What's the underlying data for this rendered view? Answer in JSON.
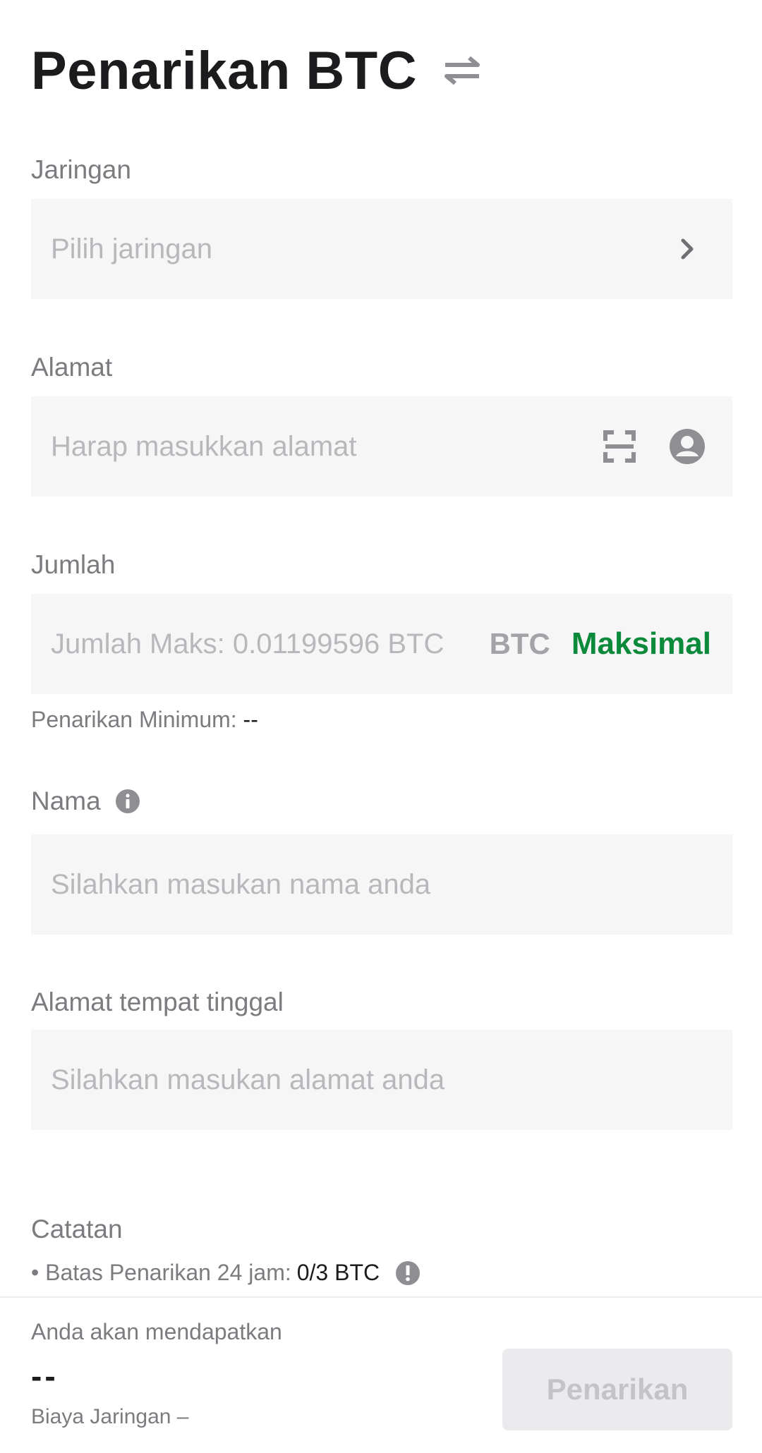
{
  "header": {
    "title": "Penarikan BTC",
    "swap_icon": "swap-arrows-icon"
  },
  "network": {
    "label": "Jaringan",
    "placeholder": "Pilih jaringan",
    "chevron_icon": "chevron-right-icon"
  },
  "address": {
    "label": "Alamat",
    "placeholder": "Harap masukkan alamat",
    "scan_icon": "scan-icon",
    "contact_icon": "contact-icon"
  },
  "amount": {
    "label": "Jumlah",
    "placeholder": "Jumlah Maks: 0.01199596 BTC",
    "unit": "BTC",
    "max_label": "Maksimal",
    "min_label": "Penarikan Minimum:",
    "min_value": "--"
  },
  "name": {
    "label": "Nama",
    "info_icon": "info-icon",
    "placeholder": "Silahkan masukan nama anda"
  },
  "residence": {
    "label": "Alamat tempat tinggal",
    "placeholder": "Silahkan masukan alamat anda"
  },
  "notes": {
    "title": "Catatan",
    "limit_label": "• Batas Penarikan 24 jam:",
    "limit_value": "0/3 BTC",
    "warning_icon": "alert-icon"
  },
  "footer": {
    "receive_label": "Anda akan mendapatkan",
    "receive_value": "--",
    "fee_label": "Biaya Jaringan –",
    "submit_label": "Penarikan"
  },
  "colors": {
    "accent_green": "#0b8a3b",
    "field_bg": "#f6f6f7",
    "label_gray": "#7b7b80",
    "placeholder_gray": "#b8b8bc"
  }
}
